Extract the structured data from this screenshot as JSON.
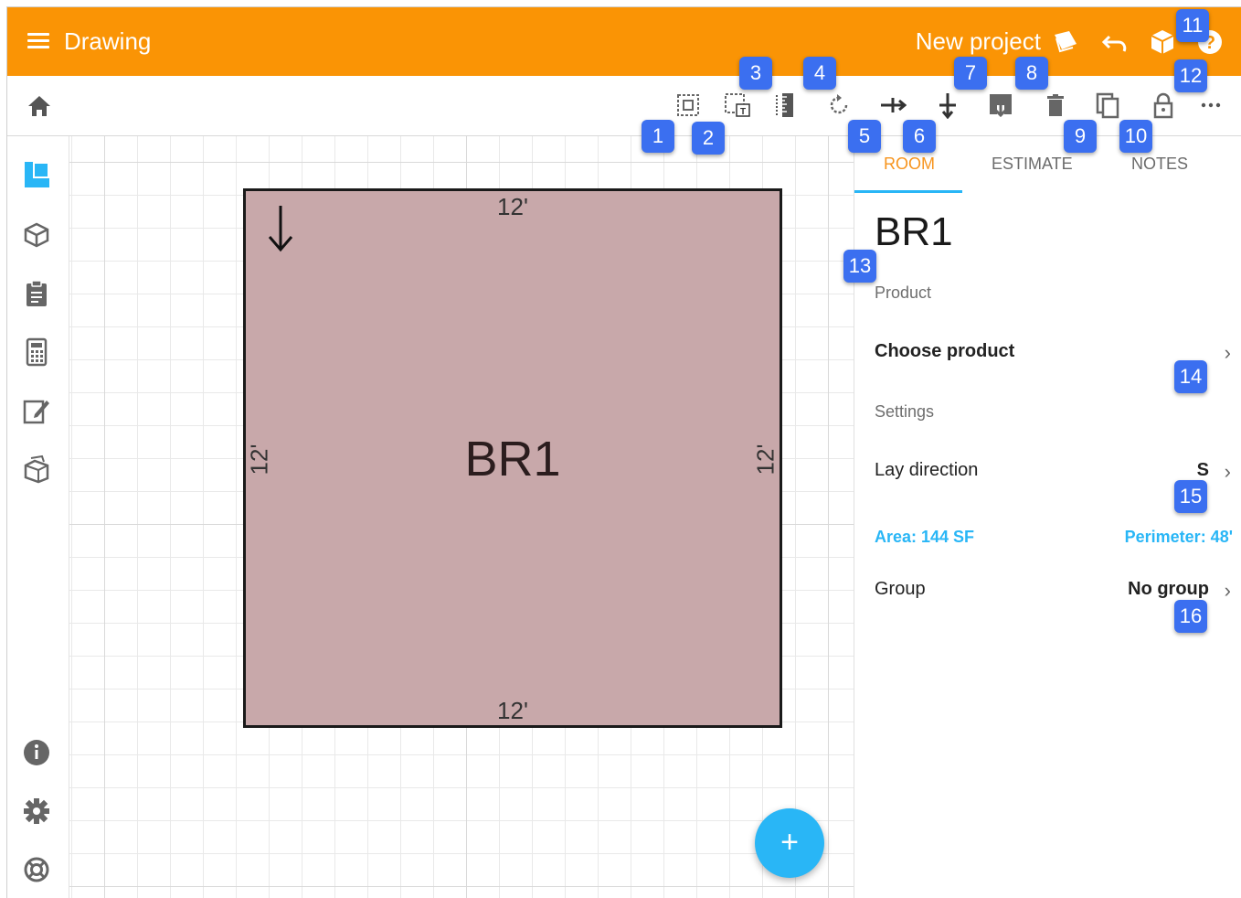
{
  "appbar": {
    "title": "Drawing",
    "project": "New project",
    "background": "#fa9405"
  },
  "toolbar": {
    "icons": [
      "select-area-icon",
      "select-text-area-icon",
      "ruler-icon",
      "rotate-icon",
      "split-horizontal-icon",
      "split-vertical-icon",
      "download-icon",
      "delete-icon",
      "copy-icon",
      "lock-icon",
      "more-icon"
    ]
  },
  "rail": {
    "icons": [
      "floor-plan-icon",
      "3d-box-icon",
      "clipboard-icon",
      "calculator-icon",
      "edit-note-icon",
      "products-icon",
      "info-icon",
      "settings-icon",
      "help-lifebuoy-icon"
    ]
  },
  "canvas": {
    "room": {
      "label": "BR1",
      "dim_top": "12'",
      "dim_bottom": "12'",
      "dim_left": "12'",
      "dim_right": "12'",
      "fill": "#c8a8aa"
    },
    "fab_label": "+"
  },
  "panel": {
    "tabs": [
      {
        "label": "ROOM",
        "active": true
      },
      {
        "label": "ESTIMATE",
        "active": false
      },
      {
        "label": "NOTES",
        "active": false
      }
    ],
    "room_name": "BR1",
    "product_section": "Product",
    "choose_product": "Choose product",
    "settings_section": "Settings",
    "lay_direction_label": "Lay direction",
    "lay_direction_value": "S",
    "area": "Area:  144 SF",
    "perimeter": "Perimeter:  48'",
    "group_label": "Group",
    "group_value": "No group",
    "chevron": "›"
  },
  "badges": [
    "1",
    "2",
    "3",
    "4",
    "5",
    "6",
    "7",
    "8",
    "9",
    "10",
    "11",
    "12",
    "13",
    "14",
    "15",
    "16"
  ]
}
